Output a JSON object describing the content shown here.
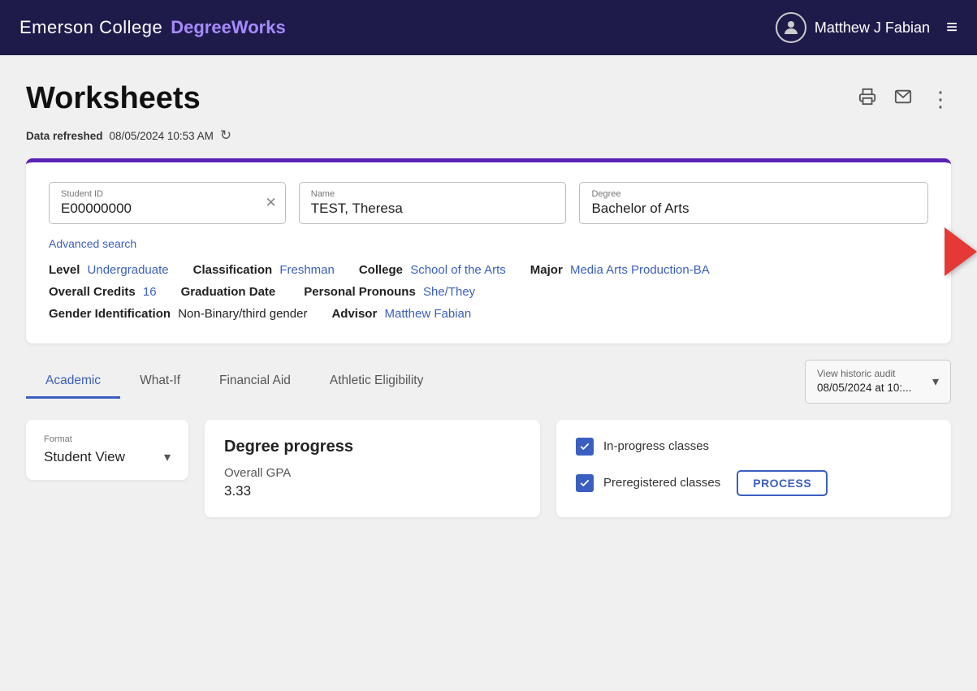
{
  "header": {
    "logo_text": "Emerson College",
    "logo_sub": "DegreeWorks",
    "user_name": "Matthew J Fabian",
    "user_icon": "👤"
  },
  "page": {
    "title": "Worksheets",
    "data_refreshed_label": "Data refreshed",
    "data_refreshed_value": "08/05/2024 10:53 AM",
    "print_icon": "🖨",
    "email_icon": "✉",
    "more_icon": "⋮",
    "refresh_icon": "↻"
  },
  "student_card": {
    "student_id_label": "Student ID",
    "student_id_value": "E00000000",
    "name_label": "Name",
    "name_value": "TEST, Theresa",
    "degree_label": "Degree",
    "degree_value": "Bachelor of Arts",
    "advanced_search": "Advanced search",
    "level_label": "Level",
    "level_value": "Undergraduate",
    "classification_label": "Classification",
    "classification_value": "Freshman",
    "college_label": "College",
    "college_value": "School of the Arts",
    "major_label": "Major",
    "major_value": "Media Arts Production-BA",
    "overall_credits_label": "Overall Credits",
    "overall_credits_value": "16",
    "graduation_date_label": "Graduation Date",
    "graduation_date_value": "",
    "personal_pronouns_label": "Personal Pronouns",
    "personal_pronouns_value": "She/They",
    "gender_id_label": "Gender Identification",
    "gender_id_value": "Non-Binary/third gender",
    "advisor_label": "Advisor",
    "advisor_value": "Matthew Fabian"
  },
  "tabs": {
    "items": [
      {
        "id": "academic",
        "label": "Academic",
        "active": true
      },
      {
        "id": "what-if",
        "label": "What-If",
        "active": false
      },
      {
        "id": "financial-aid",
        "label": "Financial Aid",
        "active": false
      },
      {
        "id": "athletic",
        "label": "Athletic Eligibility",
        "active": false
      }
    ],
    "view_historic_label": "View historic audit",
    "view_historic_value": "08/05/2024 at 10:..."
  },
  "bottom": {
    "format_label": "Format",
    "format_value": "Student View",
    "degree_progress_title": "Degree progress",
    "gpa_label": "Overall GPA",
    "gpa_value": "3.33",
    "checkbox1_label": "In-progress classes",
    "checkbox2_label": "Preregistered classes",
    "process_btn": "PROCESS"
  }
}
